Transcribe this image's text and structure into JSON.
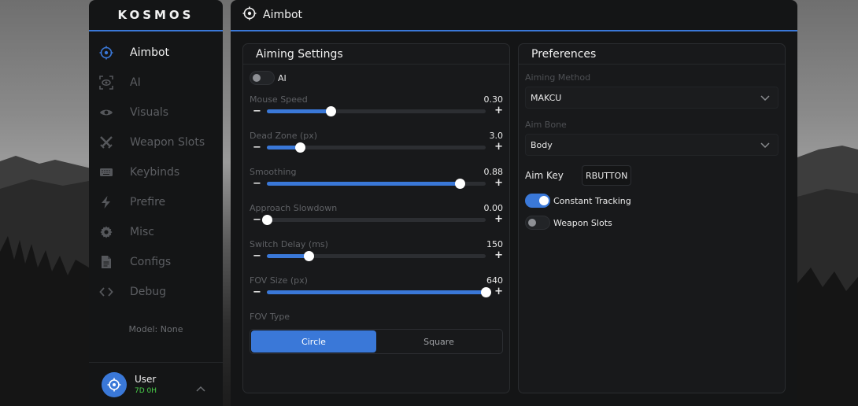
{
  "app": {
    "logo": "KOSMOS",
    "accent": "#3a78d8"
  },
  "sidebar": {
    "items": [
      {
        "label": "Aimbot",
        "icon": "crosshair-icon",
        "active": true
      },
      {
        "label": "AI",
        "icon": "eye-scan-icon",
        "active": false
      },
      {
        "label": "Visuals",
        "icon": "eye-icon",
        "active": false
      },
      {
        "label": "Weapon Slots",
        "icon": "crossed-swords-icon",
        "active": false
      },
      {
        "label": "Keybinds",
        "icon": "keyboard-icon",
        "active": false
      },
      {
        "label": "Prefire",
        "icon": "bolt-icon",
        "active": false
      },
      {
        "label": "Misc",
        "icon": "gear-icon",
        "active": false
      },
      {
        "label": "Configs",
        "icon": "file-icon",
        "active": false
      },
      {
        "label": "Debug",
        "icon": "code-icon",
        "active": false
      }
    ],
    "model": "Model: None",
    "user": {
      "name": "User",
      "time": "7D 0H"
    }
  },
  "header": {
    "title": "Aimbot"
  },
  "aiming": {
    "title": "Aiming Settings",
    "ai_toggle": {
      "label": "AI",
      "on": false
    },
    "sliders": [
      {
        "label": "Mouse Speed",
        "value": "0.30",
        "fraction": 0.29
      },
      {
        "label": "Dead Zone (px)",
        "value": "3.0",
        "fraction": 0.15
      },
      {
        "label": "Smoothing",
        "value": "0.88",
        "fraction": 0.88
      },
      {
        "label": "Approach Slowdown",
        "value": "0.00",
        "fraction": 0.0
      },
      {
        "label": "Switch Delay (ms)",
        "value": "150",
        "fraction": 0.19
      },
      {
        "label": "FOV Size (px)",
        "value": "640",
        "fraction": 1.0
      }
    ],
    "fov_type": {
      "label": "FOV Type",
      "options": [
        "Circle",
        "Square"
      ],
      "selected": "Circle"
    }
  },
  "preferences": {
    "title": "Preferences",
    "aiming_method": {
      "label": "Aiming Method",
      "value": "MAKCU"
    },
    "aim_bone": {
      "label": "Aim Bone",
      "value": "Body"
    },
    "aim_key": {
      "label": "Aim Key",
      "value": "RBUTTON"
    },
    "constant_tracking": {
      "label": "Constant Tracking",
      "on": true
    },
    "weapon_slots": {
      "label": "Weapon Slots",
      "on": false
    }
  }
}
